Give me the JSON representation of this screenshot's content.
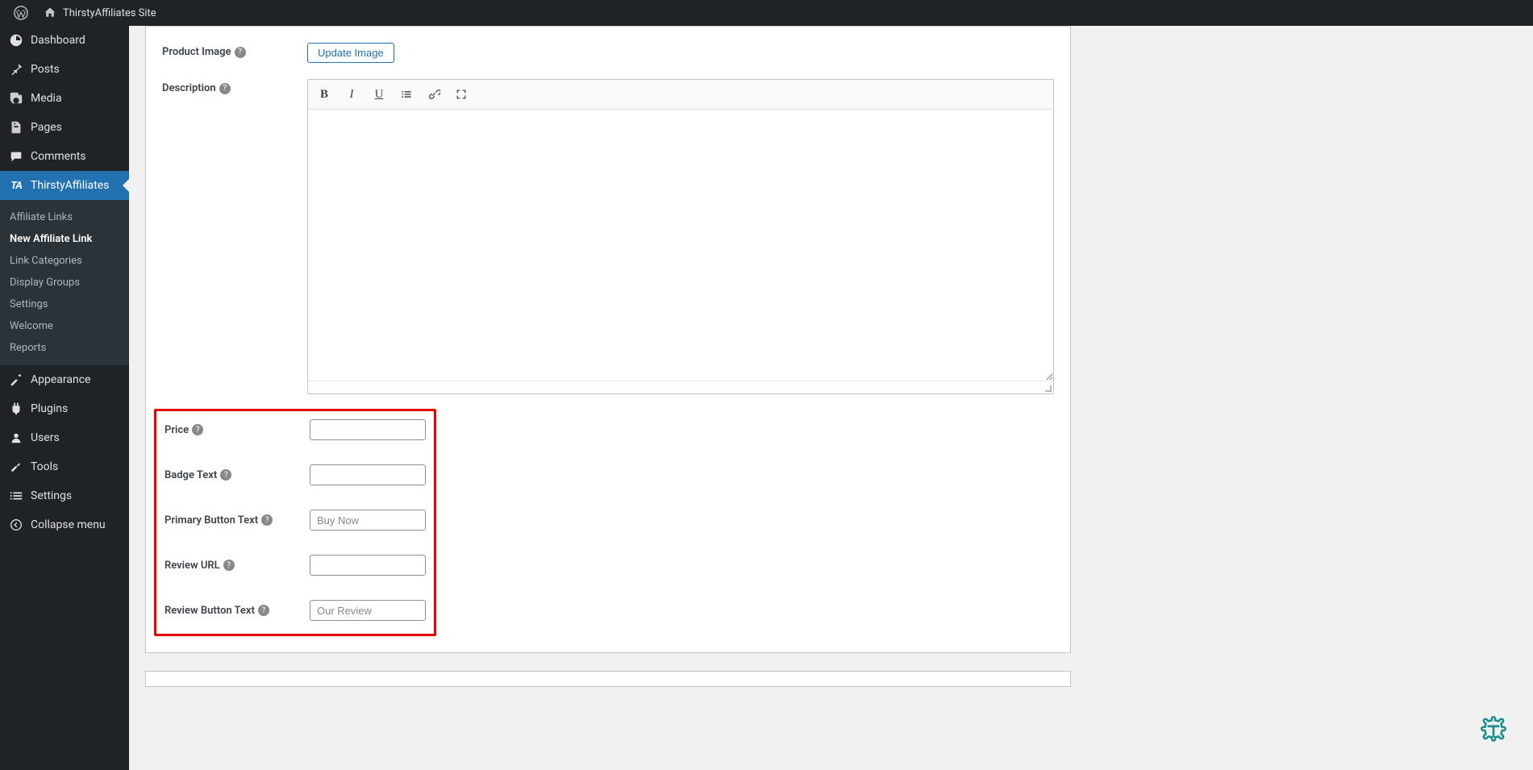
{
  "adminBar": {
    "siteName": "ThirstyAffiliates Site"
  },
  "sidebar": {
    "items": [
      {
        "label": "Dashboard"
      },
      {
        "label": "Posts"
      },
      {
        "label": "Media"
      },
      {
        "label": "Pages"
      },
      {
        "label": "Comments"
      },
      {
        "label": "ThirstyAffiliates"
      },
      {
        "label": "Appearance"
      },
      {
        "label": "Plugins"
      },
      {
        "label": "Users"
      },
      {
        "label": "Tools"
      },
      {
        "label": "Settings"
      }
    ],
    "collapse": "Collapse menu",
    "subItems": [
      {
        "label": "Affiliate Links"
      },
      {
        "label": "New Affiliate Link"
      },
      {
        "label": "Link Categories"
      },
      {
        "label": "Display Groups"
      },
      {
        "label": "Settings"
      },
      {
        "label": "Welcome"
      },
      {
        "label": "Reports"
      }
    ]
  },
  "form": {
    "productImage": {
      "label": "Product Image",
      "button": "Update Image"
    },
    "description": {
      "label": "Description"
    },
    "price": {
      "label": "Price",
      "value": ""
    },
    "badgeText": {
      "label": "Badge Text",
      "value": ""
    },
    "primaryButton": {
      "label": "Primary Button Text",
      "placeholder": "Buy Now",
      "value": ""
    },
    "reviewUrl": {
      "label": "Review URL",
      "value": ""
    },
    "reviewButton": {
      "label": "Review Button Text",
      "placeholder": "Our Review",
      "value": ""
    }
  }
}
